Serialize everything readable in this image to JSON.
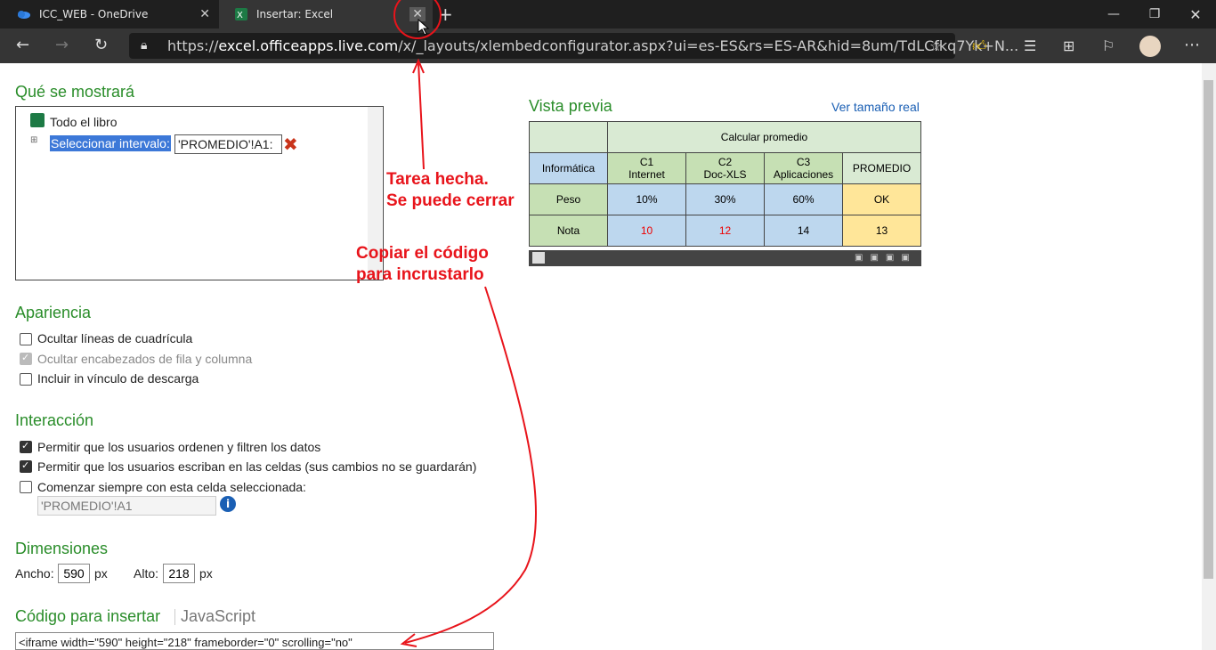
{
  "browser": {
    "tabs": [
      {
        "title": "ICC_WEB - OneDrive",
        "icon": "onedrive-cloud-icon"
      },
      {
        "title": "Insertar: Excel",
        "icon": "excel-icon"
      }
    ],
    "url_prefix": "https://",
    "url_host": "excel.officeapps.live.com",
    "url_rest": "/x/_layouts/xlembedconfigurator.aspx?ui=es-ES&rs=ES-AR&hid=8um/TdLCfkq7Yk+N..."
  },
  "sections": {
    "show": "Qué se mostrará",
    "appearance": "Apariencia",
    "interaction": "Interacción",
    "dimensions": "Dimensiones",
    "embed_code": "Código para insertar",
    "javascript": "JavaScript"
  },
  "show_options": {
    "whole_book": "Todo el libro",
    "select_range": "Seleccionar intervalo:",
    "range_value": "'PROMEDIO'!A1:"
  },
  "appearance_options": [
    {
      "label": "Ocultar líneas de cuadrícula",
      "checked": false,
      "disabled": false
    },
    {
      "label": "Ocultar encabezados de fila y columna",
      "checked": true,
      "disabled": true
    },
    {
      "label": "Incluir in vínculo de descarga",
      "checked": false,
      "disabled": false
    }
  ],
  "interaction_options": [
    {
      "label": "Permitir que los usuarios ordenen y filtren los datos",
      "checked": true
    },
    {
      "label": "Permitir que los usuarios escriban en las celdas (sus cambios no se guardarán)",
      "checked": true
    },
    {
      "label": "Comenzar siempre con esta celda seleccionada:",
      "checked": false
    }
  ],
  "start_cell": "'PROMEDIO'!A1",
  "dimensions": {
    "width_label": "Ancho:",
    "width": "590",
    "height_label": "Alto:",
    "height": "218",
    "unit": "px"
  },
  "embed_code_text": "<iframe width=\"590\" height=\"218\" frameborder=\"0\" scrolling=\"no\"",
  "preview": {
    "title": "Vista previa",
    "link": "Ver tamaño real",
    "header": "Calcular promedio",
    "cols": [
      "Informática",
      "C1\nInternet",
      "C2\nDoc-XLS",
      "C3\nAplicaciones",
      "PROMEDIO"
    ],
    "rows": [
      [
        "Peso",
        "10%",
        "30%",
        "60%",
        "OK"
      ],
      [
        "Nota",
        "10",
        "12",
        "14",
        "13"
      ]
    ]
  },
  "annotations": {
    "done1": "Tarea hecha.",
    "done2": "Se puede cerrar",
    "copy1": "Copiar el código",
    "copy2": "para incrustarlo"
  },
  "colors": {
    "section": "#2a8d2a",
    "annotation": "#e8141b",
    "link": "#1a5fb4"
  }
}
